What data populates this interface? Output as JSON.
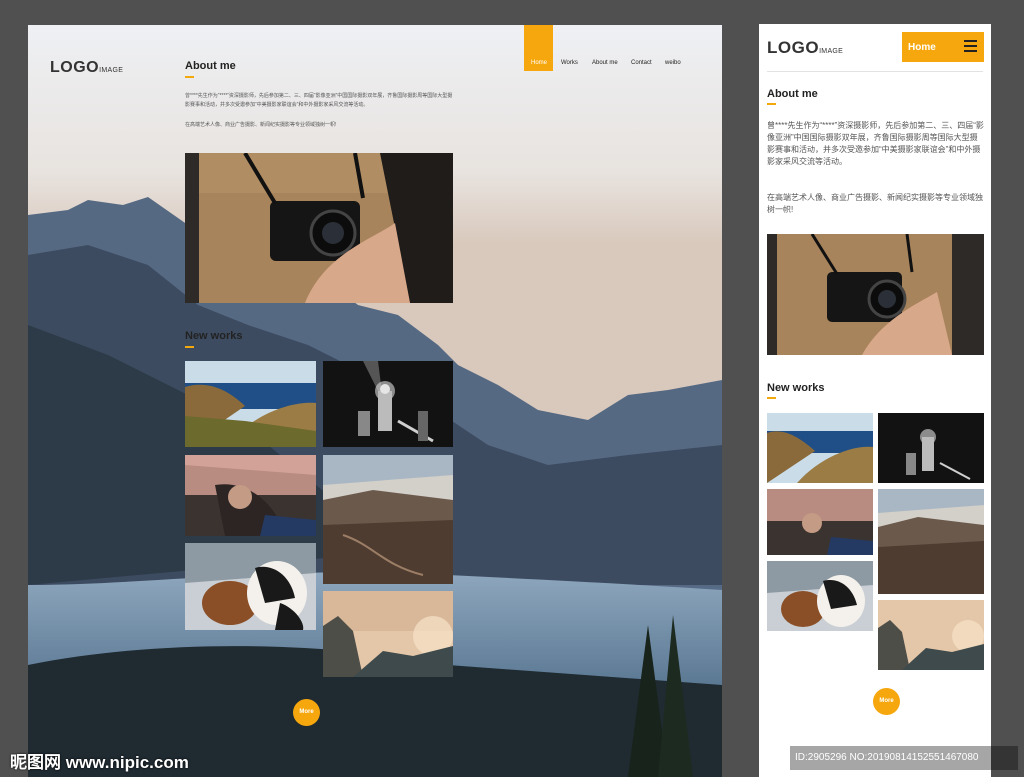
{
  "desktop": {
    "logo": {
      "main": "LOGO",
      "sub": "IMAGE"
    },
    "nav": [
      {
        "label": "Home",
        "active": true
      },
      {
        "label": "Works"
      },
      {
        "label": "About me"
      },
      {
        "label": "Contact"
      },
      {
        "label": "weibo"
      }
    ],
    "about": {
      "title": "About me",
      "para1": "曾****先生作为“****”资深摄影师，先后参加第二、三、四届“影像亚洲”中国国际摄影双年展，齐鲁国际摄影周等国际大型摄影赛事和活动，并多次受邀参加“中美摄影家联谊会”和中外摄影家采风交流等活动。",
      "para2": "在高端艺术人像、商业广告摄影、新闻纪实摄影等专业领域独树一帜!"
    },
    "works": {
      "title": "New works"
    },
    "more_label": "More"
  },
  "mobile": {
    "logo": {
      "main": "LOGO",
      "sub": "IMAGE"
    },
    "home_label": "Home",
    "about": {
      "title": "About me",
      "para1": "曾****先生作为“****”资深摄影师，先后参加第二、三、四届“影像亚洲”中国国际摄影双年展，齐鲁国际摄影周等国际大型摄影赛事和活动，并多次受邀参加“中美摄影家联谊会”和中外摄影家采风交流等活动。",
      "para2": "在高端艺术人像、商业广告摄影、新闻纪实摄影等专业领域独树一帜!"
    },
    "works": {
      "title": "New works"
    },
    "more_label": "More"
  },
  "watermark": {
    "left": "昵图网 www.nipic.com",
    "right": "ID:2905296 NO:20190814152551467080"
  },
  "colors": {
    "accent": "#f6a70d",
    "background": "#505050"
  },
  "icons": [
    "hamburger-menu-icon"
  ]
}
